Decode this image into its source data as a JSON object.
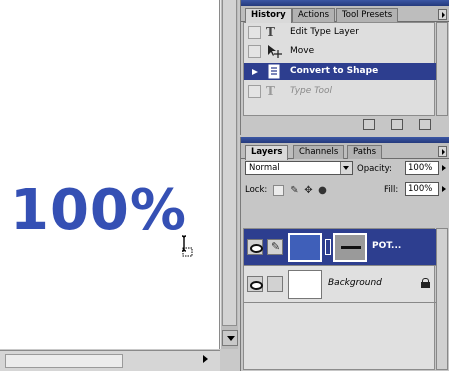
{
  "canvas": {
    "text": "100%",
    "text_color": "#3550b4",
    "cursor": "type-cursor-icon"
  },
  "history_palette": {
    "tabs": [
      {
        "label": "History",
        "active": true
      },
      {
        "label": "Actions",
        "active": false
      },
      {
        "label": "Tool Presets",
        "active": false
      }
    ],
    "items": [
      {
        "label": "Edit Type Layer",
        "icon": "type-tool-icon",
        "state": "normal"
      },
      {
        "label": "Move",
        "icon": "move-tool-icon",
        "state": "normal"
      },
      {
        "label": "Convert to Shape",
        "icon": "convert-shape-icon",
        "state": "selected"
      },
      {
        "label": "Type Tool",
        "icon": "type-tool-icon",
        "state": "dimmed"
      }
    ],
    "footer_buttons": [
      "new-document-from-state-icon",
      "new-snapshot-icon",
      "delete-state-icon"
    ],
    "selection_color": "#2d3e8f"
  },
  "layers_palette": {
    "tabs": [
      {
        "label": "Layers",
        "active": true
      },
      {
        "label": "Channels",
        "active": false
      },
      {
        "label": "Paths",
        "active": false
      }
    ],
    "blend_mode": "Normal",
    "opacity_label": "Opacity:",
    "opacity_value": "100%",
    "lock_label": "Lock:",
    "fill_label": "Fill:",
    "fill_value": "100%",
    "layers": [
      {
        "name": "POT...",
        "selected": true,
        "type": "shape",
        "shape_color": "#3f5fb9"
      },
      {
        "name": "Background",
        "selected": false,
        "type": "background",
        "locked": true
      }
    ]
  }
}
